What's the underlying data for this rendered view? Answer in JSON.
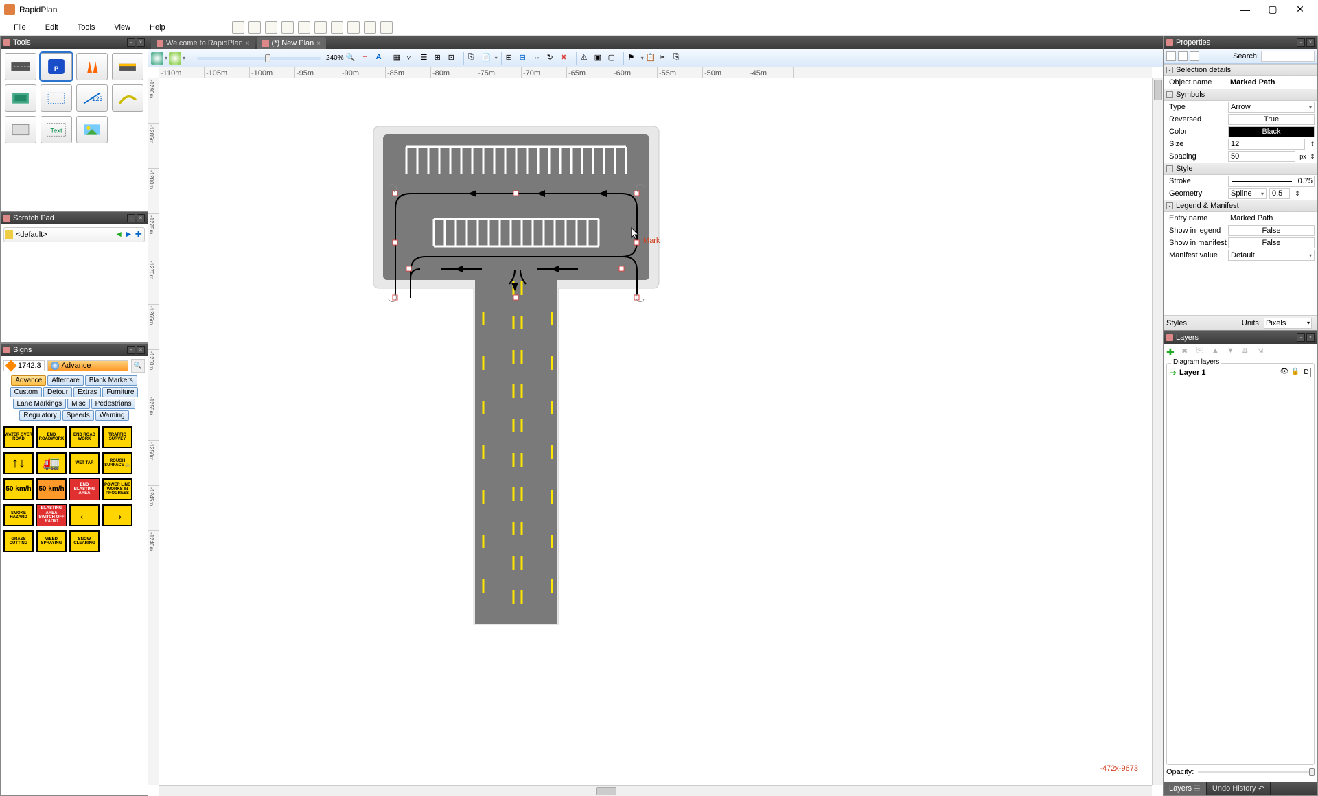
{
  "app": {
    "title": "RapidPlan"
  },
  "menubar": [
    "File",
    "Edit",
    "Tools",
    "View",
    "Help"
  ],
  "panels": {
    "tools": "Tools",
    "scratch": "Scratch Pad",
    "signs": "Signs",
    "properties": "Properties",
    "layers": "Layers"
  },
  "scratch": {
    "default_name": "<default>"
  },
  "signs_panel": {
    "version": "1742.3",
    "category_active": "Advance",
    "categories": [
      "Advance",
      "Aftercare",
      "Blank Markers",
      "Custom",
      "Detour",
      "Extras",
      "Furniture",
      "Lane Markings",
      "Misc",
      "Pedestrians",
      "Regulatory",
      "Speeds",
      "Warning"
    ],
    "signs": [
      {
        "t": "WATER OVER ROAD",
        "c": "yel"
      },
      {
        "t": "END ROADWORK",
        "c": "yel"
      },
      {
        "t": "END ROAD WORK",
        "c": "yel"
      },
      {
        "t": "TRAFFIC SURVEY",
        "c": "yel"
      },
      {
        "t": "↑↓",
        "c": "yel"
      },
      {
        "t": "🚛",
        "c": "yel"
      },
      {
        "t": "WET TAR",
        "c": "yel"
      },
      {
        "t": "ROUGH SURFACE 🚲",
        "c": "yel"
      },
      {
        "t": "50 km/h",
        "c": "yel"
      },
      {
        "t": "50 km/h",
        "c": "org"
      },
      {
        "t": "END BLASTING AREA",
        "c": "red"
      },
      {
        "t": "POWER LINE WORKS IN PROGRESS",
        "c": "yel"
      },
      {
        "t": "SMOKE HAZARD",
        "c": "yel"
      },
      {
        "t": "BLASTING AREA SWITCH OFF RADIO",
        "c": "red"
      },
      {
        "t": "←",
        "c": "yel"
      },
      {
        "t": "→",
        "c": "yel"
      },
      {
        "t": "GRASS CUTTING",
        "c": "yel"
      },
      {
        "t": "WEED SPRAYING",
        "c": "yel"
      },
      {
        "t": "SNOW CLEARING",
        "c": "yel"
      }
    ]
  },
  "tabs": [
    {
      "label": "Welcome to RapidPlan",
      "active": false
    },
    {
      "label": "(*) New Plan",
      "active": true
    }
  ],
  "zoom": "240%",
  "ruler_h": [
    "-110m",
    "-105m",
    "-100m",
    "-95m",
    "-90m",
    "-85m",
    "-80m",
    "-75m",
    "-70m",
    "-65m",
    "-60m",
    "-55m",
    "-50m",
    "-45m"
  ],
  "ruler_v": [
    "-1290m",
    "-1285m",
    "-1280m",
    "-1275m",
    "-1270m",
    "-1265m",
    "-1260m",
    "-1255m",
    "-1250m",
    "-1245m",
    "-1240m"
  ],
  "canvas": {
    "tooltip": "Marked Path",
    "coord": "-472x-9673"
  },
  "properties": {
    "search_label": "Search:",
    "groups": {
      "selection": "Selection details",
      "symbols": "Symbols",
      "style": "Style",
      "legend": "Legend & Manifest"
    },
    "rows": {
      "object_name_label": "Object name",
      "object_name": "Marked Path",
      "type_label": "Type",
      "type": "Arrow",
      "reversed_label": "Reversed",
      "reversed": "True",
      "color_label": "Color",
      "color": "Black",
      "size_label": "Size",
      "size": "12",
      "spacing_label": "Spacing",
      "spacing": "50",
      "spacing_unit": "px",
      "stroke_label": "Stroke",
      "stroke": "0.75",
      "geometry_label": "Geometry",
      "geometry": "Spline",
      "geometry_val": "0.5",
      "entry_label": "Entry name",
      "entry": "Marked Path",
      "show_legend_label": "Show in legend",
      "show_legend": "False",
      "show_manifest_label": "Show in manifest",
      "show_manifest": "False",
      "manifest_val_label": "Manifest value",
      "manifest_val": "Default"
    },
    "styles_label": "Styles:",
    "units_label": "Units:",
    "units_value": "Pixels"
  },
  "layers": {
    "fieldset": "Diagram layers",
    "layer1": "Layer 1",
    "opacity_label": "Opacity:",
    "bottom_tabs": [
      "Layers",
      "Undo History"
    ]
  }
}
